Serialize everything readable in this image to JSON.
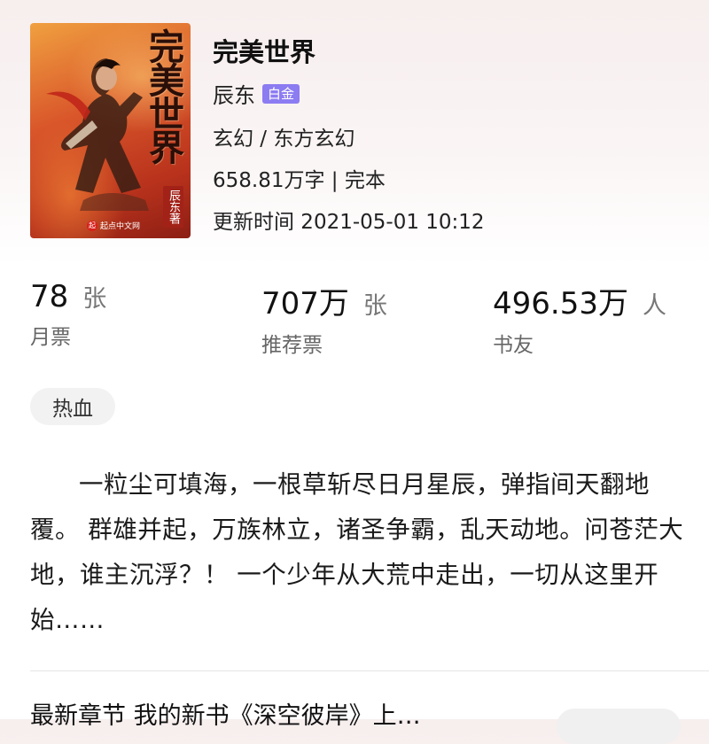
{
  "cover": {
    "title": "完美世界",
    "author": "辰东著",
    "logo_mark": "起",
    "logo_text": "起点中文网"
  },
  "book": {
    "title": "完美世界",
    "author": "辰东",
    "badge": "白金",
    "category": "玄幻 / 东方玄幻",
    "wordcount": "658.81万字 | 完本",
    "updated": "更新时间 2021-05-01 10:12"
  },
  "stats": [
    {
      "value": "78",
      "unit": "张",
      "label": "月票"
    },
    {
      "value": "707万",
      "unit": "张",
      "label": "推荐票"
    },
    {
      "value": "496.53万",
      "unit": "人",
      "label": "书友"
    }
  ],
  "tag": "热血",
  "intro": "一粒尘可填海，一根草斩尽日月星辰，弹指间天翻地覆。 群雄并起，万族林立，诸圣争霸，乱天动地。问苍茫大地，谁主沉浮？！ 一个少年从大荒中走出，一切从这里开始……",
  "latest": "最新章节 我的新书《深空彼岸》上…",
  "colors": {
    "badge": "#8c7cf2",
    "text": "#1a1a1a",
    "secondary": "#666666"
  }
}
